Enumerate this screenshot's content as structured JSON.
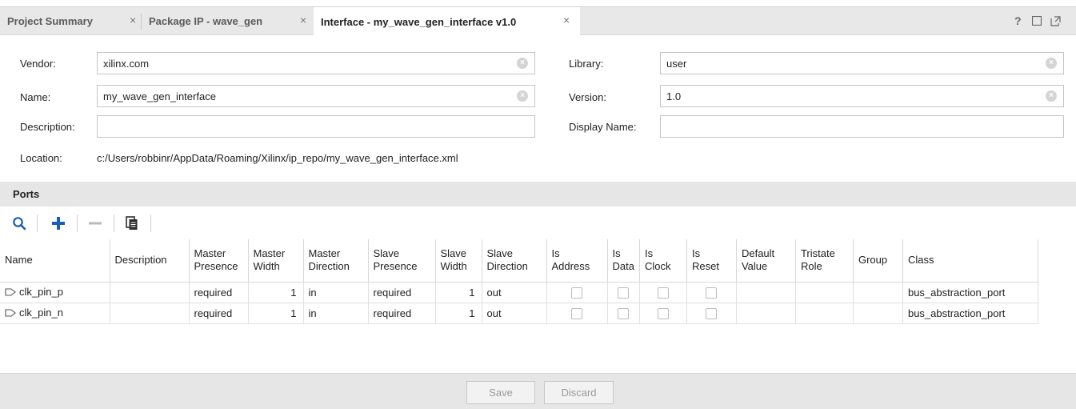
{
  "tabs": [
    {
      "label": "Project Summary",
      "active": false
    },
    {
      "label": "Package IP - wave_gen",
      "active": false
    },
    {
      "label": "Interface - my_wave_gen_interface v1.0",
      "active": true
    }
  ],
  "window_controls": {
    "help": "?"
  },
  "form": {
    "vendor_label": "Vendor:",
    "vendor_value": "xilinx.com",
    "name_label": "Name:",
    "name_value": "my_wave_gen_interface",
    "description_label": "Description:",
    "description_value": "",
    "location_label": "Location:",
    "location_value": "c:/Users/robbinr/AppData/Roaming/Xilinx/ip_repo/my_wave_gen_interface.xml",
    "library_label": "Library:",
    "library_value": "user",
    "version_label": "Version:",
    "version_value": "1.0",
    "display_name_label": "Display Name:",
    "display_name_value": ""
  },
  "ports": {
    "title": "Ports",
    "toolbar_icons": [
      "search-icon",
      "add-icon",
      "remove-icon",
      "copy-icon"
    ],
    "columns": [
      {
        "line1": "Name",
        "line2": ""
      },
      {
        "line1": "Description",
        "line2": ""
      },
      {
        "line1": "Master",
        "line2": "Presence"
      },
      {
        "line1": "Master",
        "line2": "Width"
      },
      {
        "line1": "Master",
        "line2": "Direction"
      },
      {
        "line1": "Slave",
        "line2": "Presence"
      },
      {
        "line1": "Slave",
        "line2": "Width"
      },
      {
        "line1": "Slave",
        "line2": "Direction"
      },
      {
        "line1": "Is",
        "line2": "Address"
      },
      {
        "line1": "Is",
        "line2": "Data"
      },
      {
        "line1": "Is",
        "line2": "Clock"
      },
      {
        "line1": "Is",
        "line2": "Reset"
      },
      {
        "line1": "Default",
        "line2": "Value"
      },
      {
        "line1": "Tristate",
        "line2": "Role"
      },
      {
        "line1": "Group",
        "line2": ""
      },
      {
        "line1": "Class",
        "line2": ""
      }
    ],
    "rows": [
      {
        "name": "clk_pin_p",
        "description": "",
        "master_presence": "required",
        "master_width": "1",
        "master_direction": "in",
        "slave_presence": "required",
        "slave_width": "1",
        "slave_direction": "out",
        "is_address": false,
        "is_data": false,
        "is_clock": false,
        "is_reset": false,
        "default_value": "",
        "tristate_role": "",
        "group": "",
        "class": "bus_abstraction_port"
      },
      {
        "name": "clk_pin_n",
        "description": "",
        "master_presence": "required",
        "master_width": "1",
        "master_direction": "in",
        "slave_presence": "required",
        "slave_width": "1",
        "slave_direction": "out",
        "is_address": false,
        "is_data": false,
        "is_clock": false,
        "is_reset": false,
        "default_value": "",
        "tristate_role": "",
        "group": "",
        "class": "bus_abstraction_port"
      }
    ]
  },
  "footer": {
    "save_label": "Save",
    "discard_label": "Discard"
  },
  "colors": {
    "accent": "#1a5fb4",
    "panel_bg": "#e6e6e6",
    "disabled_text": "#9a9a9a"
  }
}
